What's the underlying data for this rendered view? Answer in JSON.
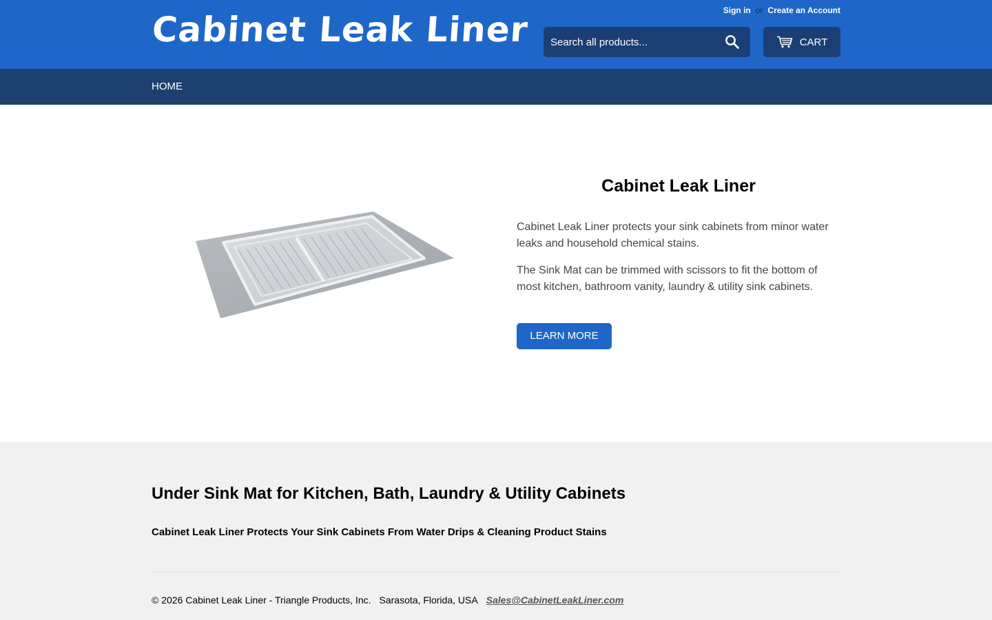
{
  "header": {
    "logo": "Cabinet Leak Liner",
    "sign_in": "Sign in",
    "or": "or",
    "create_account": "Create an Account",
    "search_placeholder": "Search all products...",
    "cart_label": "CART"
  },
  "nav": {
    "items": [
      {
        "label": "HOME"
      }
    ]
  },
  "feature": {
    "title": "Cabinet Leak Liner",
    "paragraph1": "Cabinet Leak Liner protects your sink cabinets from minor water leaks and household chemical stains.",
    "paragraph2": "The Sink Mat can be trimmed with scissors to fit the bottom of most kitchen, bathroom vanity, laundry & utility sink cabinets.",
    "button": "LEARN MORE"
  },
  "footer": {
    "heading": "Under Sink Mat for Kitchen, Bath, Laundry & Utility Cabinets",
    "subheading": "Cabinet Leak Liner Protects Your Sink Cabinets From Water Drips & Cleaning Product Stains",
    "copyright": "© 2026 Cabinet Leak Liner - Triangle Products, Inc.",
    "address": "Sarasota, Florida, USA",
    "email": "Sales@CabinetLeakLiner.com"
  },
  "icons": {
    "search": "search-icon",
    "cart": "cart-icon"
  },
  "colors": {
    "header_bg": "#1e67c8",
    "nav_bg": "#1d4070",
    "accent": "#1e67c8",
    "footer_bg": "#f1f1f1"
  }
}
